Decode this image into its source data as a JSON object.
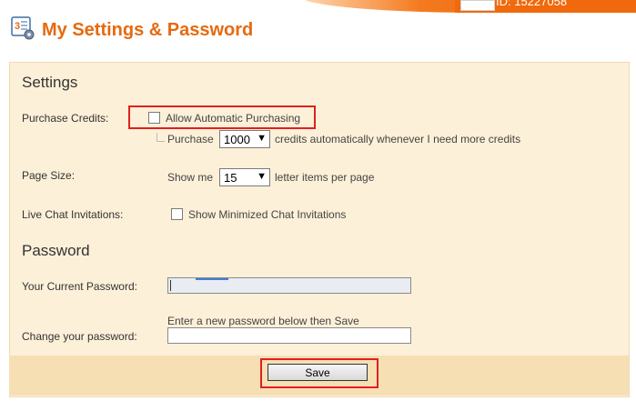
{
  "header": {
    "id_text": "ID: 15227058",
    "title": "My Settings & Password"
  },
  "settings": {
    "heading": "Settings",
    "purchase_credits": {
      "label": "Purchase Credits:",
      "auto_checkbox_label": "Allow Automatic Purchasing",
      "purchase_prefix": "Purchase",
      "amount_selected": "1000",
      "purchase_suffix": "credits automatically whenever I need more credits"
    },
    "page_size": {
      "label": "Page Size:",
      "prefix": "Show me",
      "selected": "15",
      "suffix": "letter items per page"
    },
    "live_chat": {
      "label": "Live Chat Invitations:",
      "checkbox_label": "Show Minimized Chat Invitations"
    }
  },
  "password": {
    "heading": "Password",
    "current_label": "Your Current Password:",
    "hint": "Enter a new password below then Save",
    "change_label": "Change your password:"
  },
  "footer": {
    "save_label": "Save"
  },
  "colors": {
    "accent": "#e56a10",
    "panel_bg": "#fdf0d8",
    "highlight": "#e02020"
  }
}
